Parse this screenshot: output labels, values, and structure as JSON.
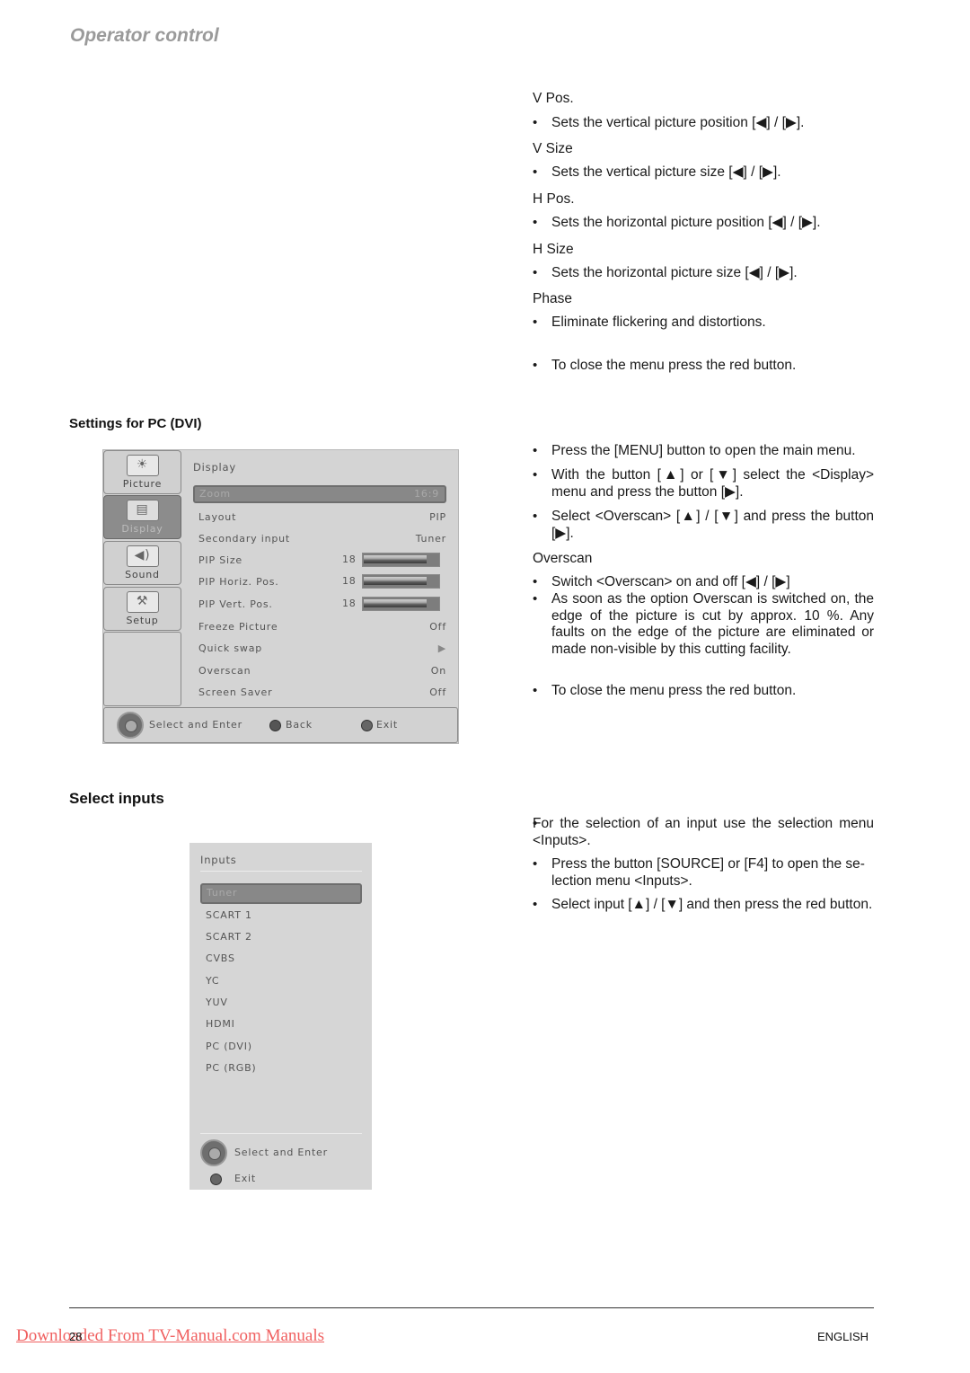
{
  "header": {
    "title": "Operator control"
  },
  "right_top": {
    "items": [
      {
        "term": "V Pos.",
        "desc": "Sets the vertical picture position [◀] / [▶]."
      },
      {
        "term": "V Size",
        "desc": "Sets the vertical picture size [◀] / [▶]."
      },
      {
        "term": "H Pos.",
        "desc": "Sets the horizontal picture position [◀] / [▶]."
      },
      {
        "term": "H Size",
        "desc": "Sets the horizontal picture size [◀] / [▶]."
      },
      {
        "term": "Phase",
        "desc": "Eliminate flickering and distortions."
      }
    ],
    "close_note": "To close the menu press the red button."
  },
  "pc_dvi": {
    "heading": "Settings for PC (DVI)",
    "menu": {
      "tabs": [
        {
          "label": "Picture",
          "icon": "sun-icon",
          "active": false
        },
        {
          "label": "Display",
          "icon": "monitor-icon",
          "active": true
        },
        {
          "label": "Sound",
          "icon": "speaker-icon",
          "active": false
        },
        {
          "label": "Setup",
          "icon": "tools-icon",
          "active": false
        }
      ],
      "title": "Display",
      "rows": [
        {
          "label": "Zoom",
          "value": "16:9",
          "selected": true
        },
        {
          "label": "Layout",
          "value": "PIP"
        },
        {
          "label": "Secondary input",
          "value": "Tuner"
        },
        {
          "label": "PIP Size",
          "value": "18",
          "slider_fraction": 0.82
        },
        {
          "label": "PIP Horiz. Pos.",
          "value": "18",
          "slider_fraction": 0.82
        },
        {
          "label": "PIP Vert. Pos.",
          "value": "18",
          "slider_fraction": 0.82
        },
        {
          "label": "Freeze Picture",
          "value": "Off"
        },
        {
          "label": "Quick swap",
          "value": "▶"
        },
        {
          "label": "Overscan",
          "value": "On"
        },
        {
          "label": "Screen Saver",
          "value": "Off"
        }
      ],
      "footer": {
        "select": "Select and Enter",
        "back": "Back",
        "exit": "Exit"
      }
    },
    "instructions": [
      "Press the [MENU] button to open the main menu.",
      "With the button [▲] or [▼] select the <Display> menu and press the button [▶].",
      "Select <Overscan> [▲] / [▼] and press the button [▶]."
    ],
    "overscan": {
      "term": "Overscan",
      "bullet": "Switch <Overscan> on and off [◀] / [▶]",
      "body": "As soon as the option Overscan is switched on, the edge of the picture is cut by approx. 10 %. Any faults on the edge of the picture are eliminated or made non-visible by this cutting facility."
    },
    "close_note": "To close the menu press the red button."
  },
  "select_inputs": {
    "heading": "Select inputs",
    "menu": {
      "title": "Inputs",
      "items": [
        "Tuner",
        "SCART 1",
        "SCART 2",
        "CVBS",
        "YC",
        "YUV",
        "HDMI",
        "PC (DVI)",
        "PC (RGB)"
      ],
      "selected": "Tuner",
      "footer": {
        "select": "Select and Enter",
        "exit": "Exit"
      }
    },
    "intro": "For the selection of an input use the selection menu <Inputs>.",
    "instructions": [
      "Press the button [SOURCE] or [F4] to open the se-lection menu <Inputs>.",
      "Select input [▲] / [▼] and then press the red button."
    ]
  },
  "footer": {
    "page_number": "28",
    "language": "ENGLISH",
    "download_link": "Downloaded From TV-Manual.com Manuals"
  }
}
